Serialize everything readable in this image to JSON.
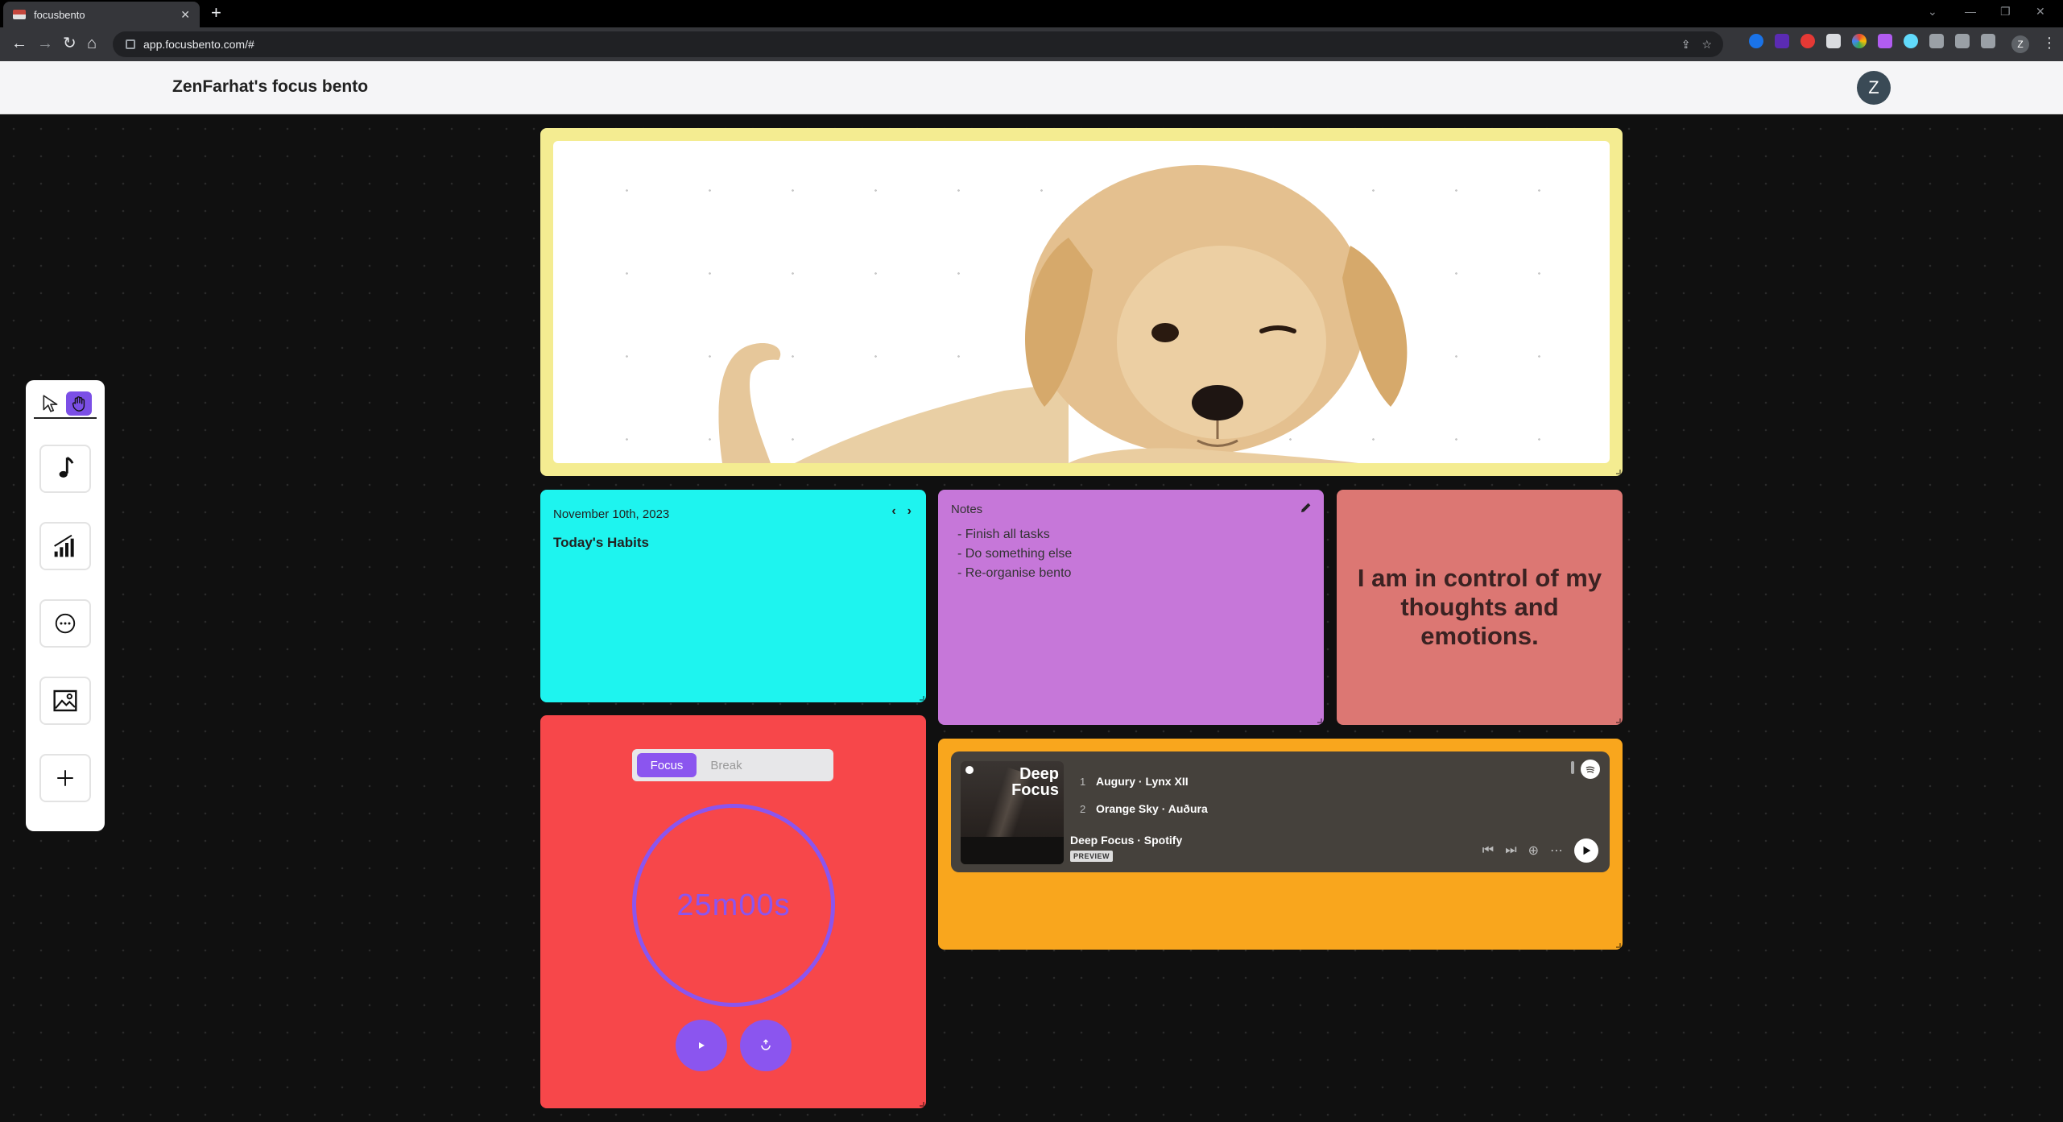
{
  "browser": {
    "tab_title": "focusbento",
    "tab_close": "✕",
    "new_tab": "+",
    "url": "app.focusbento.com/#",
    "profile_initial": "Z"
  },
  "app": {
    "title": "ZenFarhat's focus bento",
    "avatar_initial": "Z"
  },
  "toolbar": {
    "tools": [
      "pointer-icon",
      "hand-icon"
    ],
    "buttons": [
      "music-note-icon",
      "chart-icon",
      "chat-icon",
      "image-icon",
      "plus-icon"
    ]
  },
  "habits": {
    "date": "November 10th, 2023",
    "prev": "‹",
    "next": "›",
    "title": "Today's Habits"
  },
  "notes": {
    "label": "Notes",
    "items": [
      "- Finish all tasks",
      "- Do something else",
      "- Re-organise bento"
    ]
  },
  "quote": {
    "text": "I am in control of my thoughts and emotions."
  },
  "timer": {
    "focus_label": "Focus",
    "break_label": "Break",
    "value": "25m00s"
  },
  "music": {
    "cover_title_line1": "Deep",
    "cover_title_line2": "Focus",
    "tracks": [
      {
        "num": "1",
        "name": "Augury · Lynx XII"
      },
      {
        "num": "2",
        "name": "Orange Sky · Auðura"
      }
    ],
    "playlist": "Deep Focus · Spotify",
    "preview_badge": "PREVIEW"
  },
  "colors": {
    "dog_card": "#f4ec91",
    "habits_card": "#1ef4ef",
    "notes_card": "#c677d9",
    "quote_card": "#dc7773",
    "timer_card": "#f7474a",
    "music_card": "#f9a61d",
    "accent": "#8b55ef"
  }
}
